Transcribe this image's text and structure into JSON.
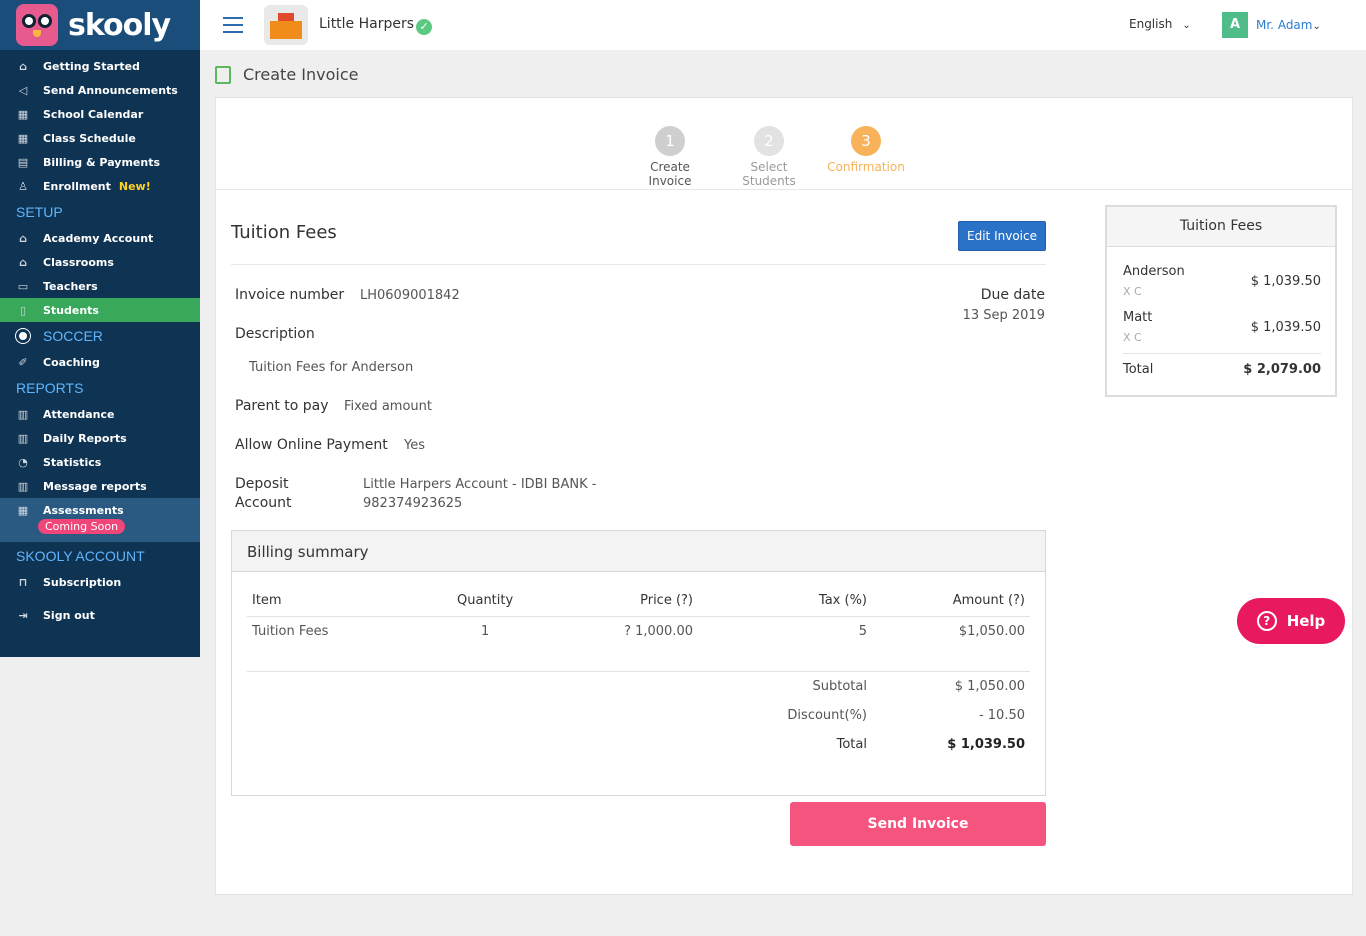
{
  "app": {
    "brand": "skooly"
  },
  "sidebar": {
    "main_items": [
      {
        "label": "Getting Started",
        "icon": "home-icon"
      },
      {
        "label": "Send Announcements",
        "icon": "megaphone-icon"
      },
      {
        "label": "School Calendar",
        "icon": "calendar-icon"
      },
      {
        "label": "Class Schedule",
        "icon": "calendar-icon"
      },
      {
        "label": "Billing & Payments",
        "icon": "billing-icon"
      },
      {
        "label": "Enrollment",
        "icon": "user-add-icon",
        "badge": "New!"
      }
    ],
    "setup_title": "SETUP",
    "setup_items": [
      {
        "label": "Academy Account",
        "icon": "building-icon"
      },
      {
        "label": "Classrooms",
        "icon": "classroom-icon"
      },
      {
        "label": "Teachers",
        "icon": "teacher-icon"
      },
      {
        "label": "Students",
        "icon": "student-icon",
        "active": true
      }
    ],
    "soccer_title": "SOCCER",
    "soccer_items": [
      {
        "label": "Coaching",
        "icon": "whistle-icon"
      }
    ],
    "reports_title": "REPORTS",
    "reports_items": [
      {
        "label": "Attendance",
        "icon": "report-icon"
      },
      {
        "label": "Daily Reports",
        "icon": "report-icon"
      },
      {
        "label": "Statistics",
        "icon": "pie-chart-icon"
      },
      {
        "label": "Message reports",
        "icon": "report-icon"
      }
    ],
    "assessments": {
      "label": "Assessments",
      "badge": "Coming Soon"
    },
    "account_title": "SKOOLY ACCOUNT",
    "account_items": [
      {
        "label": "Subscription",
        "icon": "bookmark-icon"
      },
      {
        "label": "Sign out",
        "icon": "sign-out-icon"
      }
    ]
  },
  "topbar": {
    "school_name": "Little Harpers",
    "verified_mark": "✓",
    "language": "English",
    "avatar_letter": "A",
    "user_name": "Mr. Adam"
  },
  "page": {
    "title": "Create Invoice"
  },
  "steps": [
    {
      "num": "1",
      "label": "Create Invoice"
    },
    {
      "num": "2",
      "label": "Select Students"
    },
    {
      "num": "3",
      "label": "Confirmation"
    }
  ],
  "invoice": {
    "title": "Tuition Fees",
    "edit_label": "Edit Invoice",
    "number_label": "Invoice number",
    "number": "LH0609001842",
    "due_label": "Due date",
    "due_date": "13 Sep 2019",
    "description_label": "Description",
    "description": "Tuition Fees for Anderson",
    "parent_label": "Parent to pay",
    "parent_value": "Fixed amount",
    "online_label": "Allow Online Payment",
    "online_value": "Yes",
    "deposit_label_1": "Deposit",
    "deposit_label_2": "Account",
    "deposit_value_1": "Little Harpers Account - IDBI BANK -",
    "deposit_value_2": "982374923625"
  },
  "billing": {
    "title": "Billing summary",
    "headers": {
      "item": "Item",
      "quantity": "Quantity",
      "price": "Price (?)",
      "tax": "Tax (%)",
      "amount": "Amount (?)"
    },
    "row": {
      "item": "Tuition Fees",
      "quantity": "1",
      "price": "? 1,000.00",
      "tax": "5",
      "amount": "$1,050.00"
    },
    "subtotal_label": "Subtotal",
    "subtotal": "$ 1,050.00",
    "discount_label": "Discount(%)",
    "discount": "- 10.50",
    "total_label": "Total",
    "total": "$ 1,039.50"
  },
  "send_label": "Send Invoice",
  "summary": {
    "title": "Tuition Fees",
    "students": [
      {
        "name": "Anderson",
        "sub": "X C",
        "amount": "$ 1,039.50"
      },
      {
        "name": "Matt",
        "sub": "X C",
        "amount": "$ 1,039.50"
      }
    ],
    "total_label": "Total",
    "total": "$ 2,079.00"
  },
  "help_label": "Help"
}
